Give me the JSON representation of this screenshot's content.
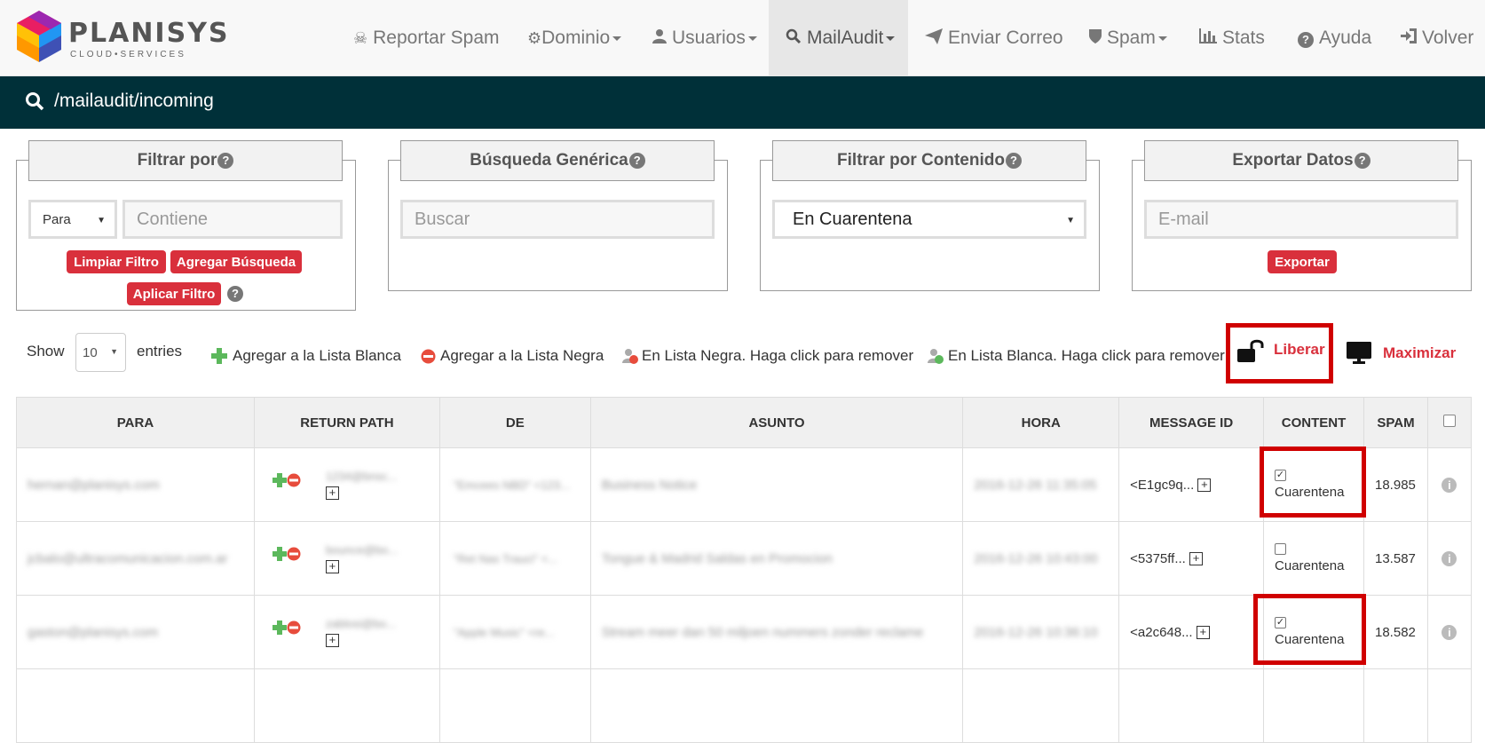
{
  "brand": {
    "name": "PLANISYS",
    "tagline": "CLOUD•SERVICES"
  },
  "nav": [
    {
      "label": "Reportar Spam",
      "icon": "skull-icon"
    },
    {
      "label": "Dominio",
      "icon": "gear-icon"
    },
    {
      "label": "Usuarios",
      "icon": "user-icon"
    },
    {
      "label": "MailAudit",
      "icon": "search-icon"
    },
    {
      "label": "Enviar Correo",
      "icon": "send-icon"
    },
    {
      "label": "Spam",
      "icon": "shield-icon"
    },
    {
      "label": "Stats",
      "icon": "bar-chart-icon"
    },
    {
      "label": "Ayuda",
      "icon": "help-icon"
    },
    {
      "label": "Volver",
      "icon": "sign-in-icon"
    }
  ],
  "path": "/mailaudit/incoming",
  "panels": {
    "filter": {
      "title": "Filtrar por",
      "select": "Para",
      "placeholder": "Contiene",
      "clear": "Limpiar Filtro",
      "add": "Agregar Búsqueda",
      "apply": "Aplicar Filtro"
    },
    "generic": {
      "title": "Búsqueda Genérica",
      "placeholder": "Buscar"
    },
    "content": {
      "title": "Filtrar por Contenido",
      "select": "En Cuarentena"
    },
    "export": {
      "title": "Exportar Datos",
      "placeholder": "E-mail",
      "button": "Exportar"
    }
  },
  "toolbar": {
    "show": "Show",
    "entries_value": "10",
    "entries": "entries",
    "whitelist_add": "Agregar a la Lista Blanca",
    "blacklist_add": "Agregar a la Lista Negra",
    "in_blacklist": "En Lista Negra. Haga click para remover",
    "in_whitelist": "En Lista Blanca. Haga click para remover",
    "release": "Liberar",
    "maximize": "Maximizar"
  },
  "table": {
    "headers": [
      "PARA",
      "RETURN PATH",
      "DE",
      "ASUNTO",
      "HORA",
      "MESSAGE ID",
      "CONTENT",
      "SPAM"
    ],
    "rows": [
      {
        "para": "hernan@planisys.com",
        "return_path": "1234@bnsc...",
        "de": "\"Emcees NBD\" <123...",
        "asunto": "Business Notice",
        "hora": "2016-12-26 11:35:05",
        "msgid": "<E1gc9q...",
        "content_checked": true,
        "content": "Cuarentena",
        "spam": "18.985"
      },
      {
        "para": "jcbalo@ultracomunicacion.com.ar",
        "return_path": "bounce@bo...",
        "de": "\"Ret Nas Trauci\" <...",
        "asunto": "Tongue & Madrid Saldas en Promocion",
        "hora": "2016-12-26 10:43:00",
        "msgid": "<5375ff...",
        "content_checked": false,
        "content": "Cuarentena",
        "spam": "13.587"
      },
      {
        "para": "gaston@planisys.com",
        "return_path": "zablosi@bo...",
        "de": "\"Apple Music\" <re...",
        "asunto": "Stream meer dan 50 miljoen nummers zonder reclame",
        "hora": "2016-12-26 10:36:10",
        "msgid": "<a2c648...",
        "content_checked": true,
        "content": "Cuarentena",
        "spam": "18.582"
      }
    ]
  },
  "colors": {
    "danger": "#d9303c",
    "highlight": "#d00000",
    "pathbar": "#003039",
    "plus": "#5cb85c"
  }
}
